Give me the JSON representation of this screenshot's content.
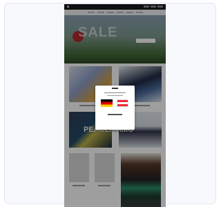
{
  "hero": {
    "headline": "SALE"
  },
  "promo": {
    "headline": "PEACEMAMO"
  },
  "popup": {
    "options": [
      {
        "flag": "germany-flag",
        "colors": [
          "#000000",
          "#dd0000",
          "#ffce00"
        ]
      },
      {
        "flag": "austria-flag",
        "colors": [
          "#ed2939",
          "#ffffff",
          "#ed2939"
        ]
      }
    ]
  },
  "colors": {
    "topbar": "#1b1b1b",
    "hero_badge": "#b0272d",
    "overlay": "rgba(0,0,0,0.38)"
  }
}
